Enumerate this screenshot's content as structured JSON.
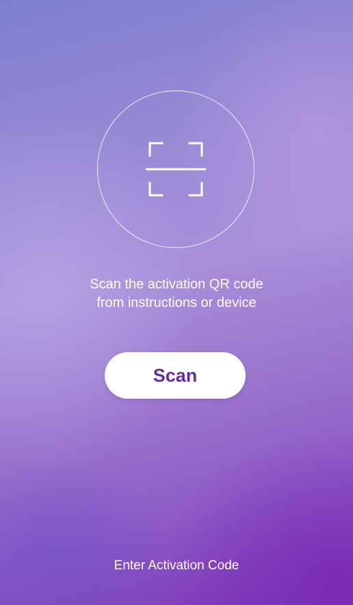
{
  "scan_panel": {
    "icon": "qr-scan-icon",
    "instruction_line1": "Scan the activation QR code",
    "instruction_line2": "from instructions or device"
  },
  "scan_button": {
    "label": "Scan"
  },
  "footer": {
    "enter_code_label": "Enter Activation Code"
  },
  "colors": {
    "button_text": "#6a2a9e",
    "background_top": "#7e7fcf",
    "background_bottom": "#7a34b8"
  }
}
